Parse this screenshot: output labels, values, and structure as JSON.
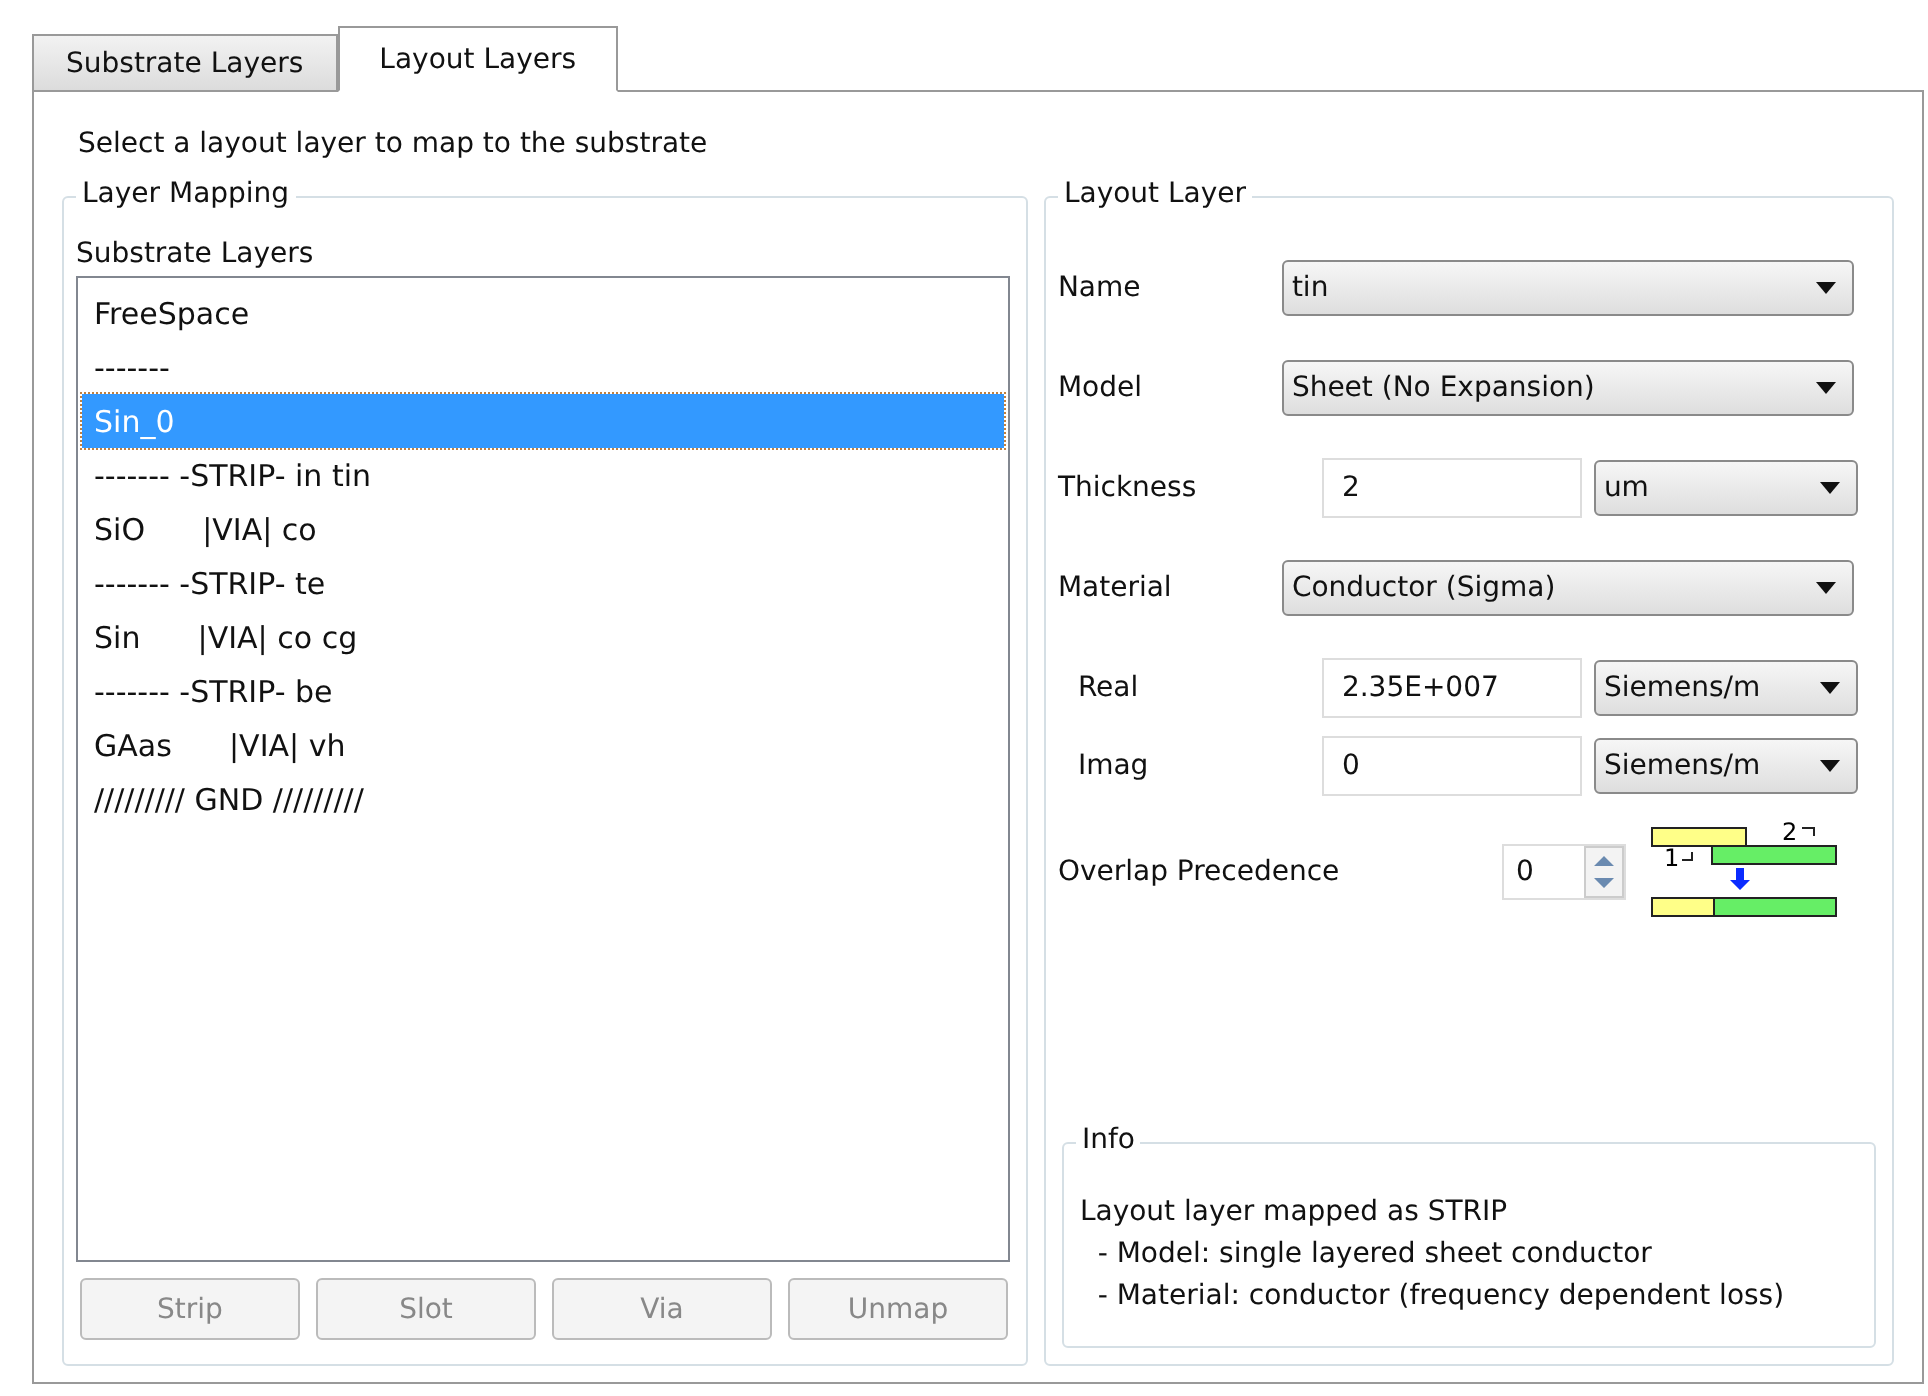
{
  "tabs": [
    {
      "label": "Substrate Layers",
      "selected": false
    },
    {
      "label": "Layout Layers",
      "selected": true
    }
  ],
  "instruction": "Select a layout layer to map to the substrate",
  "layer_mapping": {
    "title": "Layer Mapping",
    "list_label": "Substrate Layers",
    "items": [
      {
        "text": "FreeSpace",
        "selected": false
      },
      {
        "text": "-------",
        "selected": false
      },
      {
        "text": "Sin_0",
        "selected": true
      },
      {
        "text": "------- -STRIP- in tin",
        "selected": false
      },
      {
        "text": "SiO      |VIA| co",
        "selected": false
      },
      {
        "text": "------- -STRIP- te",
        "selected": false
      },
      {
        "text": "Sin      |VIA| co cg",
        "selected": false
      },
      {
        "text": "------- -STRIP- be",
        "selected": false
      },
      {
        "text": "GAas      |VIA| vh",
        "selected": false
      },
      {
        "text": "///////// GND /////////",
        "selected": false
      }
    ],
    "buttons": [
      {
        "label": "Strip",
        "disabled": true
      },
      {
        "label": "Slot",
        "disabled": true
      },
      {
        "label": "Via",
        "disabled": true
      },
      {
        "label": "Unmap",
        "disabled": true
      }
    ]
  },
  "layout_layer": {
    "title": "Layout Layer",
    "fields": [
      {
        "kind": "select",
        "label": "Name",
        "value": "tin"
      },
      {
        "kind": "select",
        "label": "Model",
        "value": "Sheet (No Expansion)"
      },
      {
        "kind": "value_unit",
        "label": "Thickness",
        "value": "2",
        "unit": "um"
      },
      {
        "kind": "select",
        "label": "Material",
        "value": "Conductor (Sigma)"
      },
      {
        "kind": "value_unit",
        "label": "Real",
        "value": "2.35E+007",
        "unit": "Siemens/m",
        "indent": true
      },
      {
        "kind": "value_unit",
        "label": "Imag",
        "value": "0",
        "unit": "Siemens/m",
        "indent": true
      }
    ],
    "overlap": {
      "label": "Overlap Precedence",
      "value": "0",
      "diagram_labels": [
        "2",
        "1"
      ]
    },
    "info": {
      "title": "Info",
      "lines": [
        "Layout layer mapped as STRIP",
        "  - Model: single layered sheet conductor",
        "  - Material: conductor (frequency dependent loss)"
      ]
    }
  }
}
